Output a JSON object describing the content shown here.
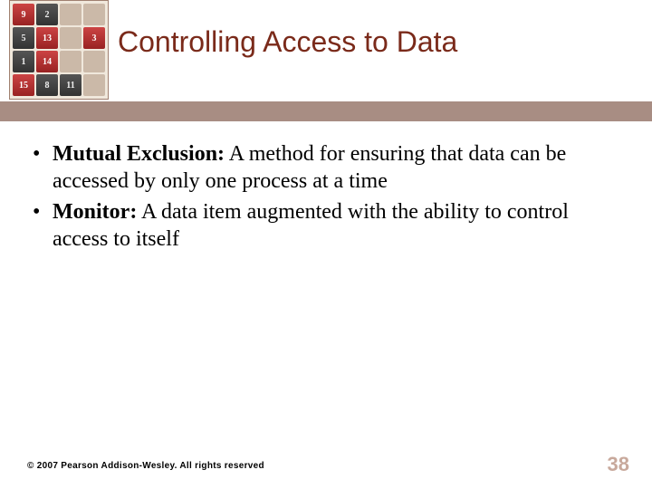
{
  "title": "Controlling Access to Data",
  "bullets": [
    {
      "term": "Mutual Exclusion:",
      "text": " A method for ensuring that data can be accessed by only one process at a time"
    },
    {
      "term": "Monitor:",
      "text": " A data item augmented with the ability to control access to itself"
    }
  ],
  "footer": "© 2007 Pearson Addison-Wesley. All rights reserved",
  "page_number": "38",
  "puzzle_tiles": [
    {
      "n": "9",
      "cls": "red"
    },
    {
      "n": "2",
      "cls": "dark"
    },
    {
      "n": "",
      "cls": "empty"
    },
    {
      "n": "",
      "cls": "empty"
    },
    {
      "n": "5",
      "cls": "dark"
    },
    {
      "n": "13",
      "cls": "red"
    },
    {
      "n": "",
      "cls": "empty"
    },
    {
      "n": "3",
      "cls": "red"
    },
    {
      "n": "1",
      "cls": "dark"
    },
    {
      "n": "14",
      "cls": "red"
    },
    {
      "n": "",
      "cls": "empty"
    },
    {
      "n": "",
      "cls": "empty"
    },
    {
      "n": "15",
      "cls": "red"
    },
    {
      "n": "8",
      "cls": "dark"
    },
    {
      "n": "11",
      "cls": "dark"
    },
    {
      "n": "",
      "cls": "empty"
    }
  ]
}
